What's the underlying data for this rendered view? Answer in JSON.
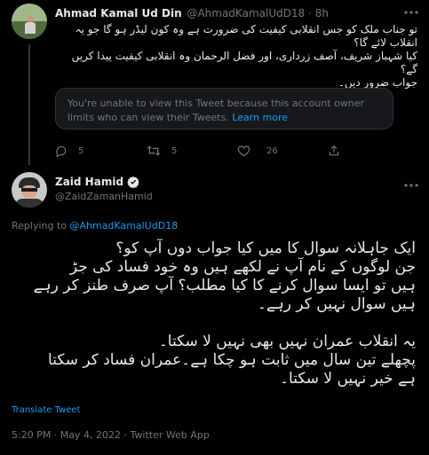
{
  "tweet1": {
    "author_name": "Ahmad Kamal Ud Din",
    "author_handle": "@AhmadKamalUdD18",
    "separator": "·",
    "time_ago": "8h",
    "text_lines": [
      "تو جناب ملک کو جس انقلابی کیفیت کی ضرورت ہے وہ کون لیڈر ہو گا جو یہ",
      "انقلاب لائے گا؟",
      "کیا شہباز شریف، آصف زرداری، اور فضل الرحمان وہ انقلابی کیفیت پیدا کریں گے؟",
      "جواب ضرور دیں۔"
    ],
    "notice_text": "You're unable to view this Tweet because this account owner limits who can view their Tweets.",
    "notice_link": "Learn more",
    "actions": {
      "replies": "5",
      "retweets": "5",
      "likes": "26"
    }
  },
  "tweet2": {
    "author_name": "Zaid Hamid",
    "author_handle": "@ZaidZamanHamid",
    "replying_prefix": "Replying to",
    "replying_handle": "@AhmadKamalUdD18",
    "text_lines": [
      "ایک جاہلانہ سوال کا میں کیا جواب دوں آپ کو؟",
      "جن لوگوں کے نام آپ نے لکھے ہیں وہ خود فساد کی جڑ",
      "ہیں تو ایسا سوال کرنے کا کیا مطلب؟ آپ صرف طنز کر رہے",
      "ہیں سوال نہیں کر رہے۔",
      "",
      "یہ انقلاب عمران نہیں بھی نہیں لا سکتا۔",
      "پچھلے تین سال میں ثابت ہو چکا ہے۔عمران فساد کر سکتا",
      "ہے خیر نہیں لا سکتا۔"
    ],
    "translate_label": "Translate Tweet",
    "timestamp": "5:20 PM · May 4, 2022 · Twitter Web App"
  },
  "colors": {
    "background": "#000000",
    "text": "#e7e9ea",
    "muted": "#71767b",
    "accent": "#1d9bf0"
  },
  "icons": [
    "avatar",
    "more-icon",
    "reply-icon",
    "retweet-icon",
    "like-icon",
    "share-icon",
    "verified-badge-icon"
  ]
}
